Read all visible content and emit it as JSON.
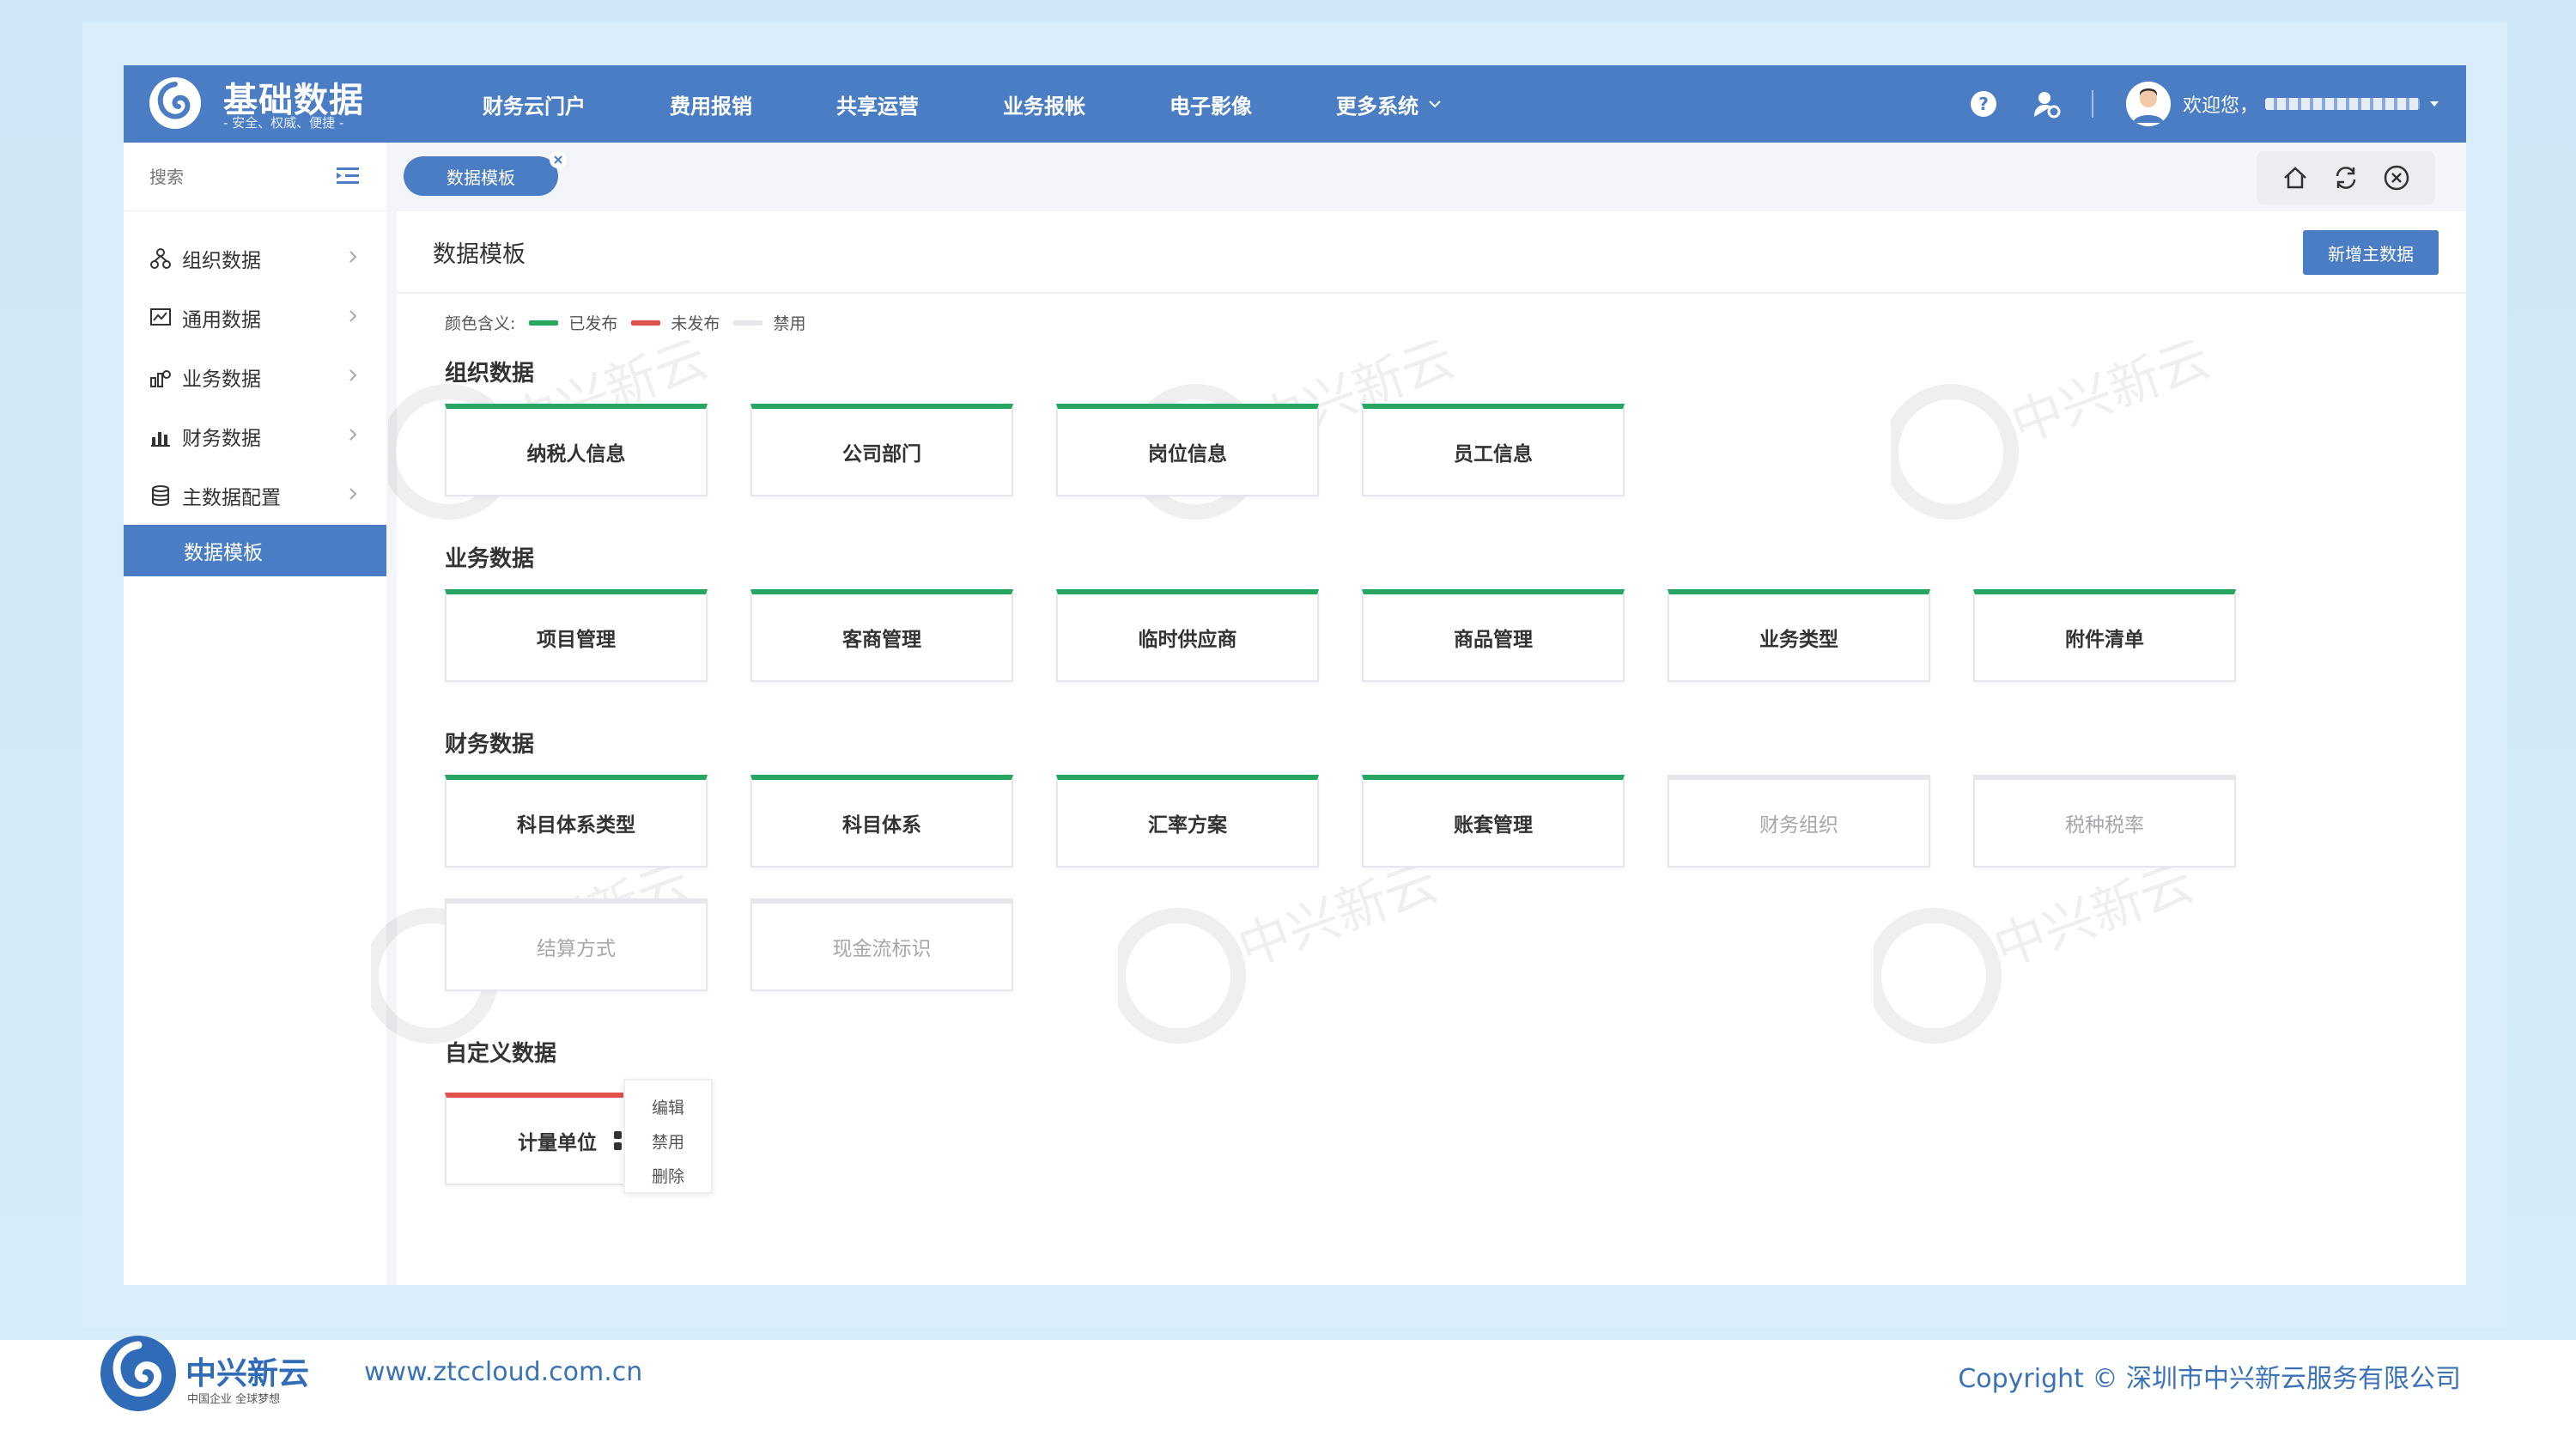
{
  "app": {
    "title": "基础数据",
    "slogan": "- 安全、权威、便捷 -"
  },
  "nav": {
    "items": [
      "财务云门户",
      "费用报销",
      "共享运营",
      "业务报帐",
      "电子影像",
      "更多系统"
    ]
  },
  "user": {
    "welcome": "欢迎您，"
  },
  "sidebar": {
    "search_placeholder": "搜索",
    "items": [
      {
        "label": "组织数据",
        "icon": "org-icon"
      },
      {
        "label": "通用数据",
        "icon": "general-data-icon"
      },
      {
        "label": "业务数据",
        "icon": "business-data-icon"
      },
      {
        "label": "财务数据",
        "icon": "finance-data-icon"
      },
      {
        "label": "主数据配置",
        "icon": "database-icon"
      }
    ],
    "active_sub": "数据模板"
  },
  "tab": {
    "active": "数据模板"
  },
  "page": {
    "title": "数据模板",
    "add_button": "新增主数据"
  },
  "legend": {
    "label": "颜色含义:",
    "items": [
      {
        "label": "已发布",
        "color": "#26a661"
      },
      {
        "label": "未发布",
        "color": "#e0524b"
      },
      {
        "label": "禁用",
        "color": "#e5e7ea"
      }
    ]
  },
  "sections": {
    "org": {
      "title": "组织数据",
      "cards": [
        {
          "label": "纳税人信息",
          "status": "published"
        },
        {
          "label": "公司部门",
          "status": "published"
        },
        {
          "label": "岗位信息",
          "status": "published"
        },
        {
          "label": "员工信息",
          "status": "published"
        }
      ]
    },
    "business": {
      "title": "业务数据",
      "cards": [
        {
          "label": "项目管理",
          "status": "published"
        },
        {
          "label": "客商管理",
          "status": "published"
        },
        {
          "label": "临时供应商",
          "status": "published"
        },
        {
          "label": "商品管理",
          "status": "published"
        },
        {
          "label": "业务类型",
          "status": "published"
        },
        {
          "label": "附件清单",
          "status": "published"
        }
      ]
    },
    "finance": {
      "title": "财务数据",
      "cards": [
        {
          "label": "科目体系类型",
          "status": "published"
        },
        {
          "label": "科目体系",
          "status": "published"
        },
        {
          "label": "汇率方案",
          "status": "published"
        },
        {
          "label": "账套管理",
          "status": "published"
        },
        {
          "label": "财务组织",
          "status": "disabled"
        },
        {
          "label": "税种税率",
          "status": "disabled"
        },
        {
          "label": "结算方式",
          "status": "disabled"
        },
        {
          "label": "现金流标识",
          "status": "disabled"
        }
      ]
    },
    "custom": {
      "title": "自定义数据",
      "cards": [
        {
          "label": "计量单位",
          "status": "unpublished"
        }
      ]
    }
  },
  "card_menu": {
    "items": [
      "编辑",
      "禁用",
      "删除"
    ]
  },
  "footer": {
    "brand": "中兴新云",
    "brand_sub": "中国企业  全球梦想",
    "url": "www.ztccloud.com.cn",
    "copyright": "Copyright © 深圳市中兴新云服务有限公司"
  },
  "watermark": "中兴新云",
  "colors": {
    "primary": "#4a7dc3",
    "published": "#26a661",
    "unpublished": "#e0524b",
    "disabled": "#e5e7ea"
  }
}
